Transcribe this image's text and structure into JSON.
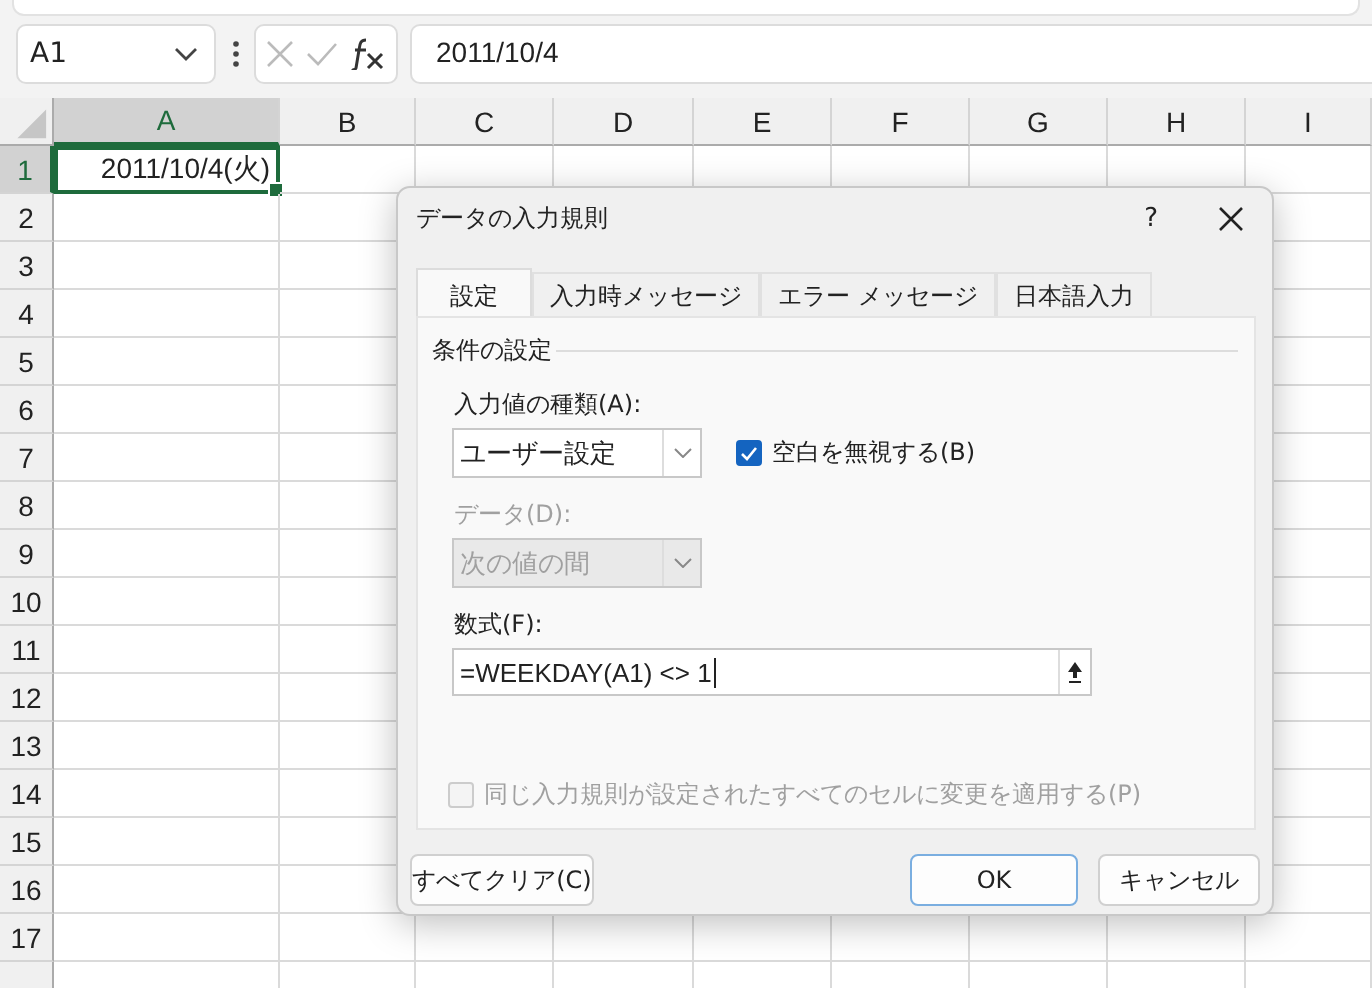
{
  "name_box": {
    "value": "A1"
  },
  "formula_bar": {
    "value": "2011/10/4"
  },
  "columns": [
    {
      "label": "A",
      "selected": true
    },
    {
      "label": "B",
      "selected": false
    },
    {
      "label": "C",
      "selected": false
    },
    {
      "label": "D",
      "selected": false
    },
    {
      "label": "E",
      "selected": false
    },
    {
      "label": "F",
      "selected": false
    },
    {
      "label": "G",
      "selected": false
    },
    {
      "label": "H",
      "selected": false
    },
    {
      "label": "I",
      "selected": false
    }
  ],
  "rows": [
    {
      "label": "1",
      "selected": true,
      "cell_a": "2011/10/4(火)"
    },
    {
      "label": "2",
      "selected": false
    },
    {
      "label": "3",
      "selected": false
    },
    {
      "label": "4",
      "selected": false
    },
    {
      "label": "5",
      "selected": false
    },
    {
      "label": "6",
      "selected": false
    },
    {
      "label": "7",
      "selected": false
    },
    {
      "label": "8",
      "selected": false
    },
    {
      "label": "9",
      "selected": false
    },
    {
      "label": "10",
      "selected": false
    },
    {
      "label": "11",
      "selected": false
    },
    {
      "label": "12",
      "selected": false
    },
    {
      "label": "13",
      "selected": false
    },
    {
      "label": "14",
      "selected": false
    },
    {
      "label": "15",
      "selected": false
    },
    {
      "label": "16",
      "selected": false
    },
    {
      "label": "17",
      "selected": false
    }
  ],
  "dialog": {
    "title": "データの入力規則",
    "help": "?",
    "tabs": [
      {
        "label": "設定",
        "selected": true
      },
      {
        "label": "入力時メッセージ",
        "selected": false
      },
      {
        "label": "エラー メッセージ",
        "selected": false
      },
      {
        "label": "日本語入力",
        "selected": false
      }
    ],
    "group_label": "条件の設定",
    "allow": {
      "label": "入力値の種類(A):",
      "value": "ユーザー設定",
      "disabled": false
    },
    "ignore_blank": {
      "label": "空白を無視する(B)",
      "checked": true,
      "disabled": false
    },
    "data": {
      "label": "データ(D):",
      "value": "次の値の間",
      "disabled": true
    },
    "formula": {
      "label": "数式(F):",
      "value": "=WEEKDAY(A1) <> 1"
    },
    "apply_all": {
      "label": "同じ入力規則が設定されたすべてのセルに変更を適用する(P)",
      "checked": false,
      "disabled": true
    },
    "buttons": [
      {
        "label": "すべてクリア(C)",
        "default": false
      },
      {
        "label": "OK",
        "default": true
      },
      {
        "label": "キャンセル",
        "default": false
      }
    ]
  }
}
